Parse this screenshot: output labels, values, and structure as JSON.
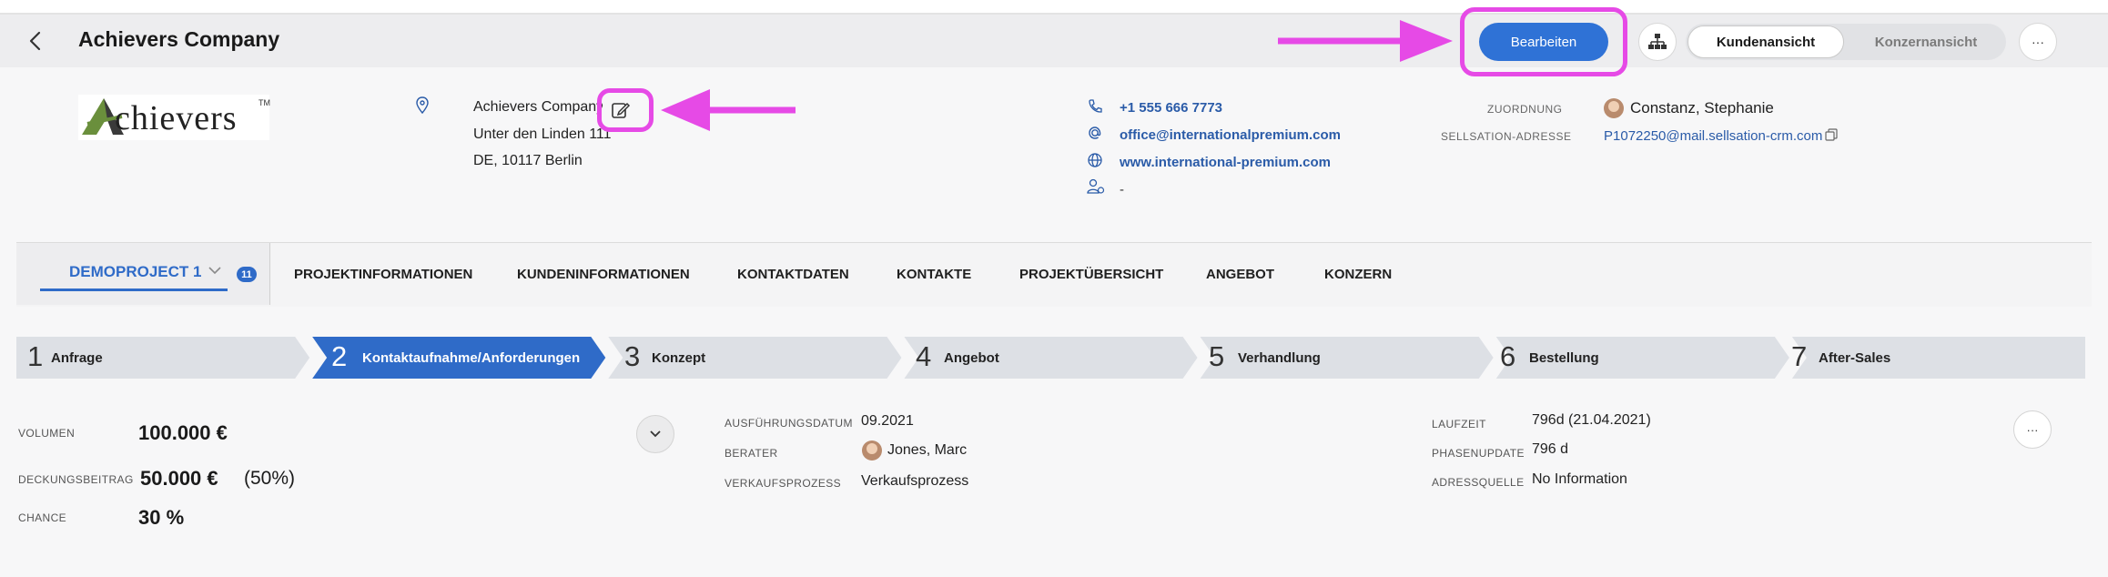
{
  "header": {
    "title": "Achievers Company",
    "edit_label": "Bearbeiten",
    "view_customer": "Kundenansicht",
    "view_group": "Konzernansicht",
    "more": "···"
  },
  "company": {
    "logo_text": "chievers",
    "logo_tm": "TM",
    "name": "Achievers Company",
    "street": "Unter den Linden 111",
    "city": "DE, 10117 Berlin"
  },
  "contact": {
    "phone": "+1 555 666 7773",
    "email": "office@internationalpremium.com",
    "website": "www.international-premium.com",
    "contact_person": "-"
  },
  "assignment": {
    "label": "ZUORDNUNG",
    "value": "Constanz, Stephanie",
    "sellsation_label": "SELLSATION-ADRESSE",
    "sellsation_value": "P1072250@mail.sellsation-crm.com"
  },
  "tabs": {
    "project": "DEMOPROJECT 1",
    "project_count": "11",
    "items": [
      "PROJEKTINFORMATIONEN",
      "KUNDENINFORMATIONEN",
      "KONTAKTDATEN",
      "KONTAKTE",
      "PROJEKTÜBERSICHT",
      "ANGEBOT",
      "KONZERN"
    ]
  },
  "steps": [
    {
      "num": "1",
      "label": "Anfrage"
    },
    {
      "num": "2",
      "label": "Kontaktaufnahme/Anforderungen"
    },
    {
      "num": "3",
      "label": "Konzept"
    },
    {
      "num": "4",
      "label": "Angebot"
    },
    {
      "num": "5",
      "label": "Verhandlung"
    },
    {
      "num": "6",
      "label": "Bestellung"
    },
    {
      "num": "7",
      "label": "After-Sales"
    }
  ],
  "metrics": {
    "volume_label": "VOLUMEN",
    "volume_value": "100.000 €",
    "margin_label": "DECKUNGSBEITRAG",
    "margin_value": "50.000 €",
    "margin_pct": "(50%)",
    "chance_label": "CHANCE",
    "chance_value": "30 %"
  },
  "details": {
    "exec_label": "AUSFÜHRUNGSDATUM",
    "exec_value": "09.2021",
    "advisor_label": "BERATER",
    "advisor_value": "Jones, Marc",
    "process_label": "VERKAUFSPROZESS",
    "process_value": "Verkaufsprozess",
    "runtime_label": "LAUFZEIT",
    "runtime_value": "796d (21.04.2021)",
    "phase_label": "PHASENUPDATE",
    "phase_value": "796 d",
    "source_label": "ADRESSQUELLE",
    "source_value": "No Information"
  },
  "colors": {
    "accent": "#2f72d6",
    "highlight": "#e64ae6",
    "step_active": "#2f6bc8",
    "step_inactive": "#dde0e5"
  }
}
